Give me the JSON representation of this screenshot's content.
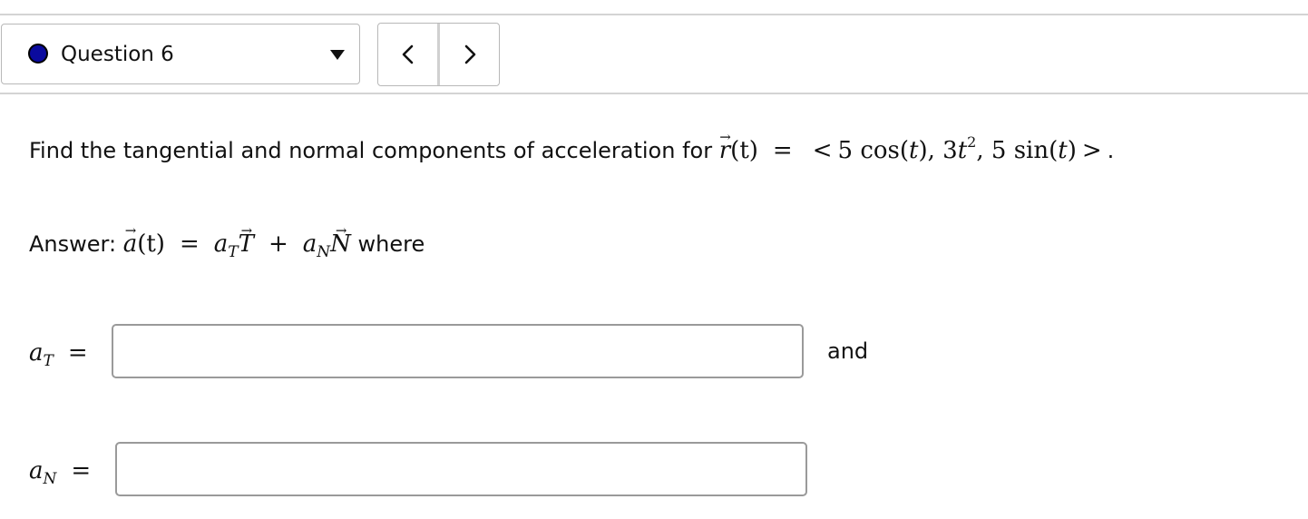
{
  "question_nav": {
    "title": "Question 6",
    "status_color": "#0a0a9e",
    "prev_label": "<",
    "next_label": ">",
    "dropdown_icon": "caret-down-icon"
  },
  "problem": {
    "text": "Find the tangential and normal components of acceleration for",
    "vector_name": "r",
    "arg": "(t)",
    "equals": "=",
    "lt": "<",
    "c1_coef": "5",
    "c1_func": "cos(",
    "c1_var": "t",
    "c1_close": "),",
    "c2_coef": "3",
    "c2_var": "t",
    "c2_exp": "2",
    "c2_sep": ",",
    "c3_coef": "5",
    "c3_func": "sin(",
    "c3_var": "t",
    "c3_close": ")",
    "gt": ">",
    "end": "."
  },
  "answer_line": {
    "prefix": "Answer:",
    "a_vec": "a",
    "arg": "(t)",
    "equals": "=",
    "aT": "a",
    "aT_sub": "T",
    "T_vec": "T",
    "plus": "+",
    "aN": "a",
    "aN_sub": "N",
    "N_vec": "N",
    "suffix": "where"
  },
  "fields": {
    "aT": {
      "label": "a",
      "sub": "T",
      "equals": "=",
      "value": "",
      "placeholder": ""
    },
    "conjunction": "and",
    "aN": {
      "label": "a",
      "sub": "N",
      "equals": "=",
      "value": "",
      "placeholder": ""
    }
  }
}
